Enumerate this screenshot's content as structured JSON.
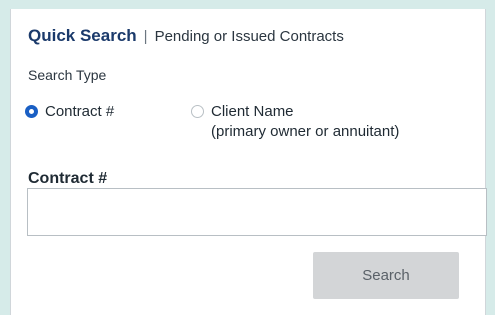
{
  "header": {
    "title": "Quick Search",
    "divider": "|",
    "subtitle": "Pending or Issued Contracts"
  },
  "search_type": {
    "label": "Search Type",
    "options": [
      {
        "label": "Contract #",
        "checked": true
      },
      {
        "label": "Client Name",
        "sublabel": "(primary owner or annuitant)",
        "checked": false
      }
    ]
  },
  "contract_field": {
    "label": "Contract #",
    "value": "",
    "placeholder": ""
  },
  "search_button": {
    "label": "Search"
  },
  "colors": {
    "background": "#d6ebe9",
    "title": "#1b3a6b",
    "radio_selected": "#1a5fc4",
    "button_disabled": "#d3d5d7"
  }
}
